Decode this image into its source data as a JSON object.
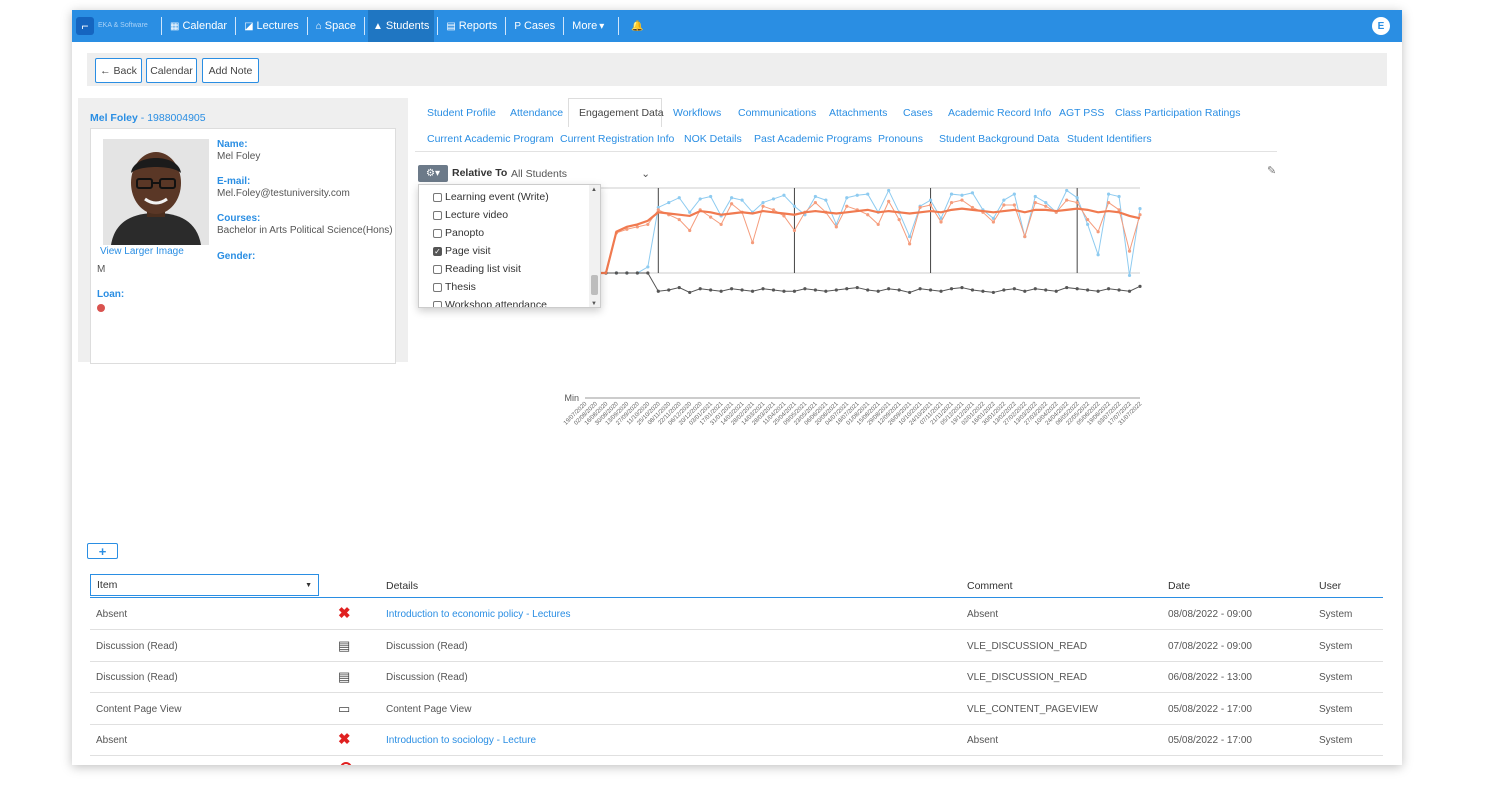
{
  "nav": {
    "brand_text": "EKA & Software",
    "items": [
      {
        "label": "Calendar",
        "icon": "calendar-icon",
        "glyph": "▦"
      },
      {
        "label": "Lectures",
        "icon": "book-icon",
        "glyph": "◪"
      },
      {
        "label": "Space",
        "icon": "building-icon",
        "glyph": "⌂"
      },
      {
        "label": "Students",
        "icon": "graduation-cap-icon",
        "glyph": "▲",
        "active": true
      },
      {
        "label": "Reports",
        "icon": "report-icon",
        "glyph": "▤"
      },
      {
        "label": "Cases",
        "icon": "cases-icon",
        "glyph": "P"
      },
      {
        "label": "More",
        "icon": "caret-down-icon",
        "glyph": "▾"
      }
    ],
    "bell_glyph": "🔔",
    "user_initial": "E"
  },
  "actions": {
    "back": "← Back",
    "calendar": "Calendar",
    "add_note": "Add Note"
  },
  "student": {
    "name": "Mel Foley",
    "id": "- 1988004905",
    "name_label": "Name:",
    "name_value": "Mel Foley",
    "email_label": "E-mail:",
    "email_value": "Mel.Foley@testuniversity.com",
    "courses_label": "Courses:",
    "courses_value": "Bachelor in Arts Political Science(Hons)",
    "gender_label": "Gender:",
    "view_larger": "View Larger Image",
    "gender_value": "M",
    "loan_label": "Loan:"
  },
  "tabs": {
    "row1": [
      "Student Profile",
      "Attendance",
      "Engagement Data",
      "Workflows",
      "Communications",
      "Attachments",
      "Cases",
      "Academic Record Info",
      "AGT PSS",
      "Class Participation Ratings"
    ],
    "row2": [
      "Current Academic Program",
      "Current Registration Info",
      "NOK Details",
      "Past Academic Programs",
      "Pronouns",
      "Student Background Data",
      "Student Identifiers"
    ],
    "active": "Engagement Data"
  },
  "chart_controls": {
    "relative_to_label": "Relative To",
    "relative_to_value": "All Students",
    "caret": "⌄"
  },
  "dropdown": [
    {
      "label": "Learning event (Write)",
      "checked": false
    },
    {
      "label": "Lecture video",
      "checked": false
    },
    {
      "label": "Panopto",
      "checked": false
    },
    {
      "label": "Page visit",
      "checked": true
    },
    {
      "label": "Reading list visit",
      "checked": false
    },
    {
      "label": "Thesis",
      "checked": false
    },
    {
      "label": "Workshop attendance",
      "checked": false
    }
  ],
  "chart_data": {
    "type": "line",
    "ylabel_min": "Min",
    "x": [
      "19/07/2020",
      "02/08/2020",
      "16/08/2020",
      "30/08/2020",
      "13/09/2020",
      "27/09/2020",
      "11/10/2020",
      "25/10/2020",
      "08/11/2020",
      "22/11/2020",
      "06/12/2020",
      "20/12/2020",
      "03/01/2021",
      "17/01/2021",
      "31/01/2021",
      "14/02/2021",
      "28/02/2021",
      "14/03/2021",
      "28/03/2021",
      "11/04/2021",
      "25/04/2021",
      "09/05/2021",
      "23/05/2021",
      "06/06/2021",
      "20/06/2021",
      "04/07/2021",
      "18/07/2021",
      "01/08/2021",
      "15/08/2021",
      "29/08/2021",
      "12/09/2021",
      "26/09/2021",
      "10/10/2021",
      "24/10/2021",
      "07/11/2021",
      "21/11/2021",
      "05/12/2021",
      "19/12/2021",
      "02/01/2022",
      "16/01/2022",
      "30/01/2022",
      "13/02/2022",
      "27/02/2022",
      "13/03/2022",
      "27/03/2022",
      "10/04/2022",
      "24/04/2022",
      "08/05/2022",
      "22/05/2022",
      "05/06/2022",
      "19/06/2022",
      "03/07/2022",
      "17/07/2022",
      "31/07/2022"
    ],
    "series": [
      {
        "color": "#8ecbf0",
        "values": [
          30,
          30,
          30,
          30,
          30,
          30,
          35,
          84,
          88,
          92,
          80,
          91,
          93,
          77,
          92,
          90,
          80,
          88,
          91,
          94,
          85,
          78,
          93,
          90,
          70,
          92,
          94,
          95,
          80,
          98,
          80,
          60,
          85,
          90,
          75,
          95,
          94,
          96,
          82,
          75,
          90,
          95,
          60,
          93,
          88,
          80,
          98,
          92,
          70,
          45,
          95,
          93,
          28,
          83
        ]
      },
      {
        "color": "#f59c7c",
        "values": [
          30,
          30,
          30,
          63,
          66,
          68,
          70,
          82,
          78,
          74,
          65,
          82,
          76,
          70,
          87,
          80,
          55,
          85,
          82,
          77,
          65,
          80,
          88,
          80,
          68,
          85,
          82,
          78,
          70,
          89,
          74,
          54,
          84,
          86,
          72,
          88,
          90,
          84,
          80,
          72,
          86,
          86,
          60,
          88,
          85,
          80,
          90,
          88,
          74,
          64,
          88,
          82,
          48,
          78
        ]
      },
      {
        "color": "#555555",
        "values": [
          30,
          30,
          30,
          30,
          30,
          30,
          30,
          15,
          16,
          18,
          14,
          17,
          16,
          15,
          17,
          16,
          15,
          17,
          16,
          15,
          15,
          17,
          16,
          15,
          16,
          17,
          18,
          16,
          15,
          17,
          16,
          14,
          17,
          16,
          15,
          17,
          18,
          16,
          15,
          14,
          16,
          17,
          15,
          17,
          16,
          15,
          18,
          17,
          16,
          15,
          17,
          16,
          15,
          19
        ]
      },
      {
        "color": "#f07a50",
        "values": [
          30,
          30,
          30,
          64,
          68,
          70,
          73,
          80,
          79,
          78,
          77,
          81,
          80,
          78,
          79,
          80,
          79,
          81,
          80,
          79,
          78,
          80,
          81,
          80,
          79,
          80,
          81,
          82,
          80,
          81,
          80,
          79,
          80,
          81,
          80,
          82,
          83,
          82,
          81,
          80,
          81,
          82,
          80,
          82,
          82,
          81,
          82,
          83,
          82,
          80,
          81,
          80,
          77,
          75
        ]
      }
    ],
    "spikes": [
      7,
      20,
      33,
      47
    ],
    "ylim": [
      -40,
      100
    ]
  },
  "table": {
    "add_label": "+",
    "item_select_label": "Item",
    "headers": {
      "details": "Details",
      "comment": "Comment",
      "date": "Date",
      "user": "User"
    },
    "rows": [
      {
        "item": "Absent",
        "icon": "x-icon",
        "glyph": "✖",
        "details": "Introduction to economic policy - Lectures",
        "link": true,
        "comment": "Absent",
        "date": "08/08/2022 - 09:00",
        "user": "System"
      },
      {
        "item": "Discussion (Read)",
        "icon": "discussion-icon",
        "glyph": "▤",
        "details": "Discussion (Read)",
        "link": false,
        "comment": "VLE_DISCUSSION_READ",
        "date": "07/08/2022 - 09:00",
        "user": "System"
      },
      {
        "item": "Discussion (Read)",
        "icon": "discussion-icon",
        "glyph": "▤",
        "details": "Discussion (Read)",
        "link": false,
        "comment": "VLE_DISCUSSION_READ",
        "date": "06/08/2022 - 13:00",
        "user": "System"
      },
      {
        "item": "Content Page View",
        "icon": "laptop-icon",
        "glyph": "▭",
        "details": "Content Page View",
        "link": false,
        "comment": "VLE_CONTENT_PAGEVIEW",
        "date": "05/08/2022 - 17:00",
        "user": "System"
      },
      {
        "item": "Absent",
        "icon": "x-icon",
        "glyph": "✖",
        "details": "Introduction to sociology - Lecture",
        "link": true,
        "comment": "Absent",
        "date": "05/08/2022 - 17:00",
        "user": "System"
      }
    ]
  }
}
